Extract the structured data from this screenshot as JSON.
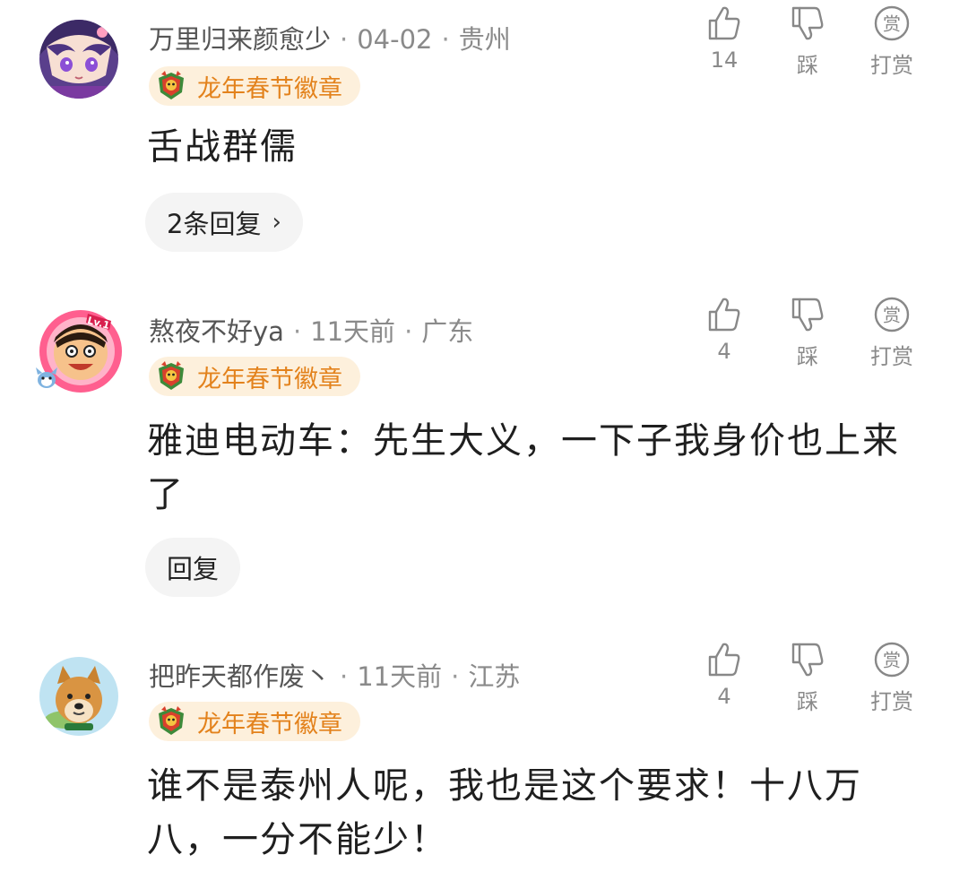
{
  "comments": [
    {
      "username": "万里归来颜愈少",
      "time": "04-02",
      "location": "贵州",
      "badge": "龙年春节徽章",
      "content": "舌战群儒",
      "reply_label": "2条回复",
      "reply_chevron": "›",
      "likes": "14",
      "dislike_label": "踩",
      "reward_label": "打赏",
      "reward_icon_char": "赏"
    },
    {
      "username": "熬夜不好ya",
      "time": "11天前",
      "location": "广东",
      "badge": "龙年春节徽章",
      "content": "雅迪电动车：先生大义，一下子我身价也上来了",
      "reply_label": "回复",
      "likes": "4",
      "dislike_label": "踩",
      "reward_label": "打赏",
      "reward_icon_char": "赏",
      "avatar_frame_label": "Lv.1"
    },
    {
      "username": "把昨天都作废丶",
      "time": "11天前",
      "location": "江苏",
      "badge": "龙年春节徽章",
      "content": "谁不是泰州人呢，我也是这个要求！十八万八，一分不能少！",
      "likes": "4",
      "dislike_label": "踩",
      "reward_label": "打赏",
      "reward_icon_char": "赏"
    }
  ],
  "separator": "·",
  "colors": {
    "badge_bg": "#fdf0dc",
    "badge_text": "#e3821c",
    "meta_text": "#8a8a8a",
    "content_text": "#1f1f1f"
  }
}
